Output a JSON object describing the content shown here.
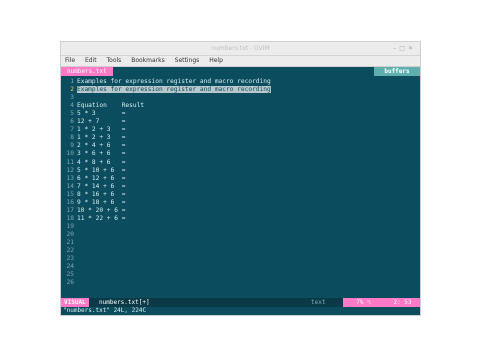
{
  "window": {
    "title": "numbers.txt - GVIM"
  },
  "menu": [
    "File",
    "Edit",
    "Tools",
    "Bookmarks",
    "Settings",
    "Help"
  ],
  "tabs": {
    "active": "numbers.txt",
    "buffers_label": "buffers"
  },
  "editor": {
    "lines": [
      {
        "n": "1",
        "text": "Examples for expression register and macro recording"
      },
      {
        "n": "2",
        "text": "Examples for expression register and macro recording"
      },
      {
        "n": "3",
        "text": ""
      },
      {
        "n": "4",
        "text": "Equation    Result"
      },
      {
        "n": "5",
        "text": "5 * 3       ="
      },
      {
        "n": "6",
        "text": "12 + 7      ="
      },
      {
        "n": "7",
        "text": "1 * 2 + 3   ="
      },
      {
        "n": "8",
        "text": "1 * 2 + 3   ="
      },
      {
        "n": "9",
        "text": "2 * 4 + 6   ="
      },
      {
        "n": "10",
        "text": "3 * 6 + 6   ="
      },
      {
        "n": "11",
        "text": "4 * 8 + 6   ="
      },
      {
        "n": "12",
        "text": "5 * 10 + 6  ="
      },
      {
        "n": "13",
        "text": "6 * 12 + 6  ="
      },
      {
        "n": "14",
        "text": "7 * 14 + 6  ="
      },
      {
        "n": "15",
        "text": "8 * 16 + 6  ="
      },
      {
        "n": "16",
        "text": "9 * 18 + 6  ="
      },
      {
        "n": "17",
        "text": "10 * 20 + 6 ="
      },
      {
        "n": "18",
        "text": "11 * 22 + 6 ="
      },
      {
        "n": "19",
        "text": ""
      },
      {
        "n": "20",
        "text": ""
      },
      {
        "n": "21",
        "text": ""
      },
      {
        "n": "22",
        "text": ""
      },
      {
        "n": "23",
        "text": ""
      },
      {
        "n": "24",
        "text": ""
      },
      {
        "n": "25",
        "text": ""
      },
      {
        "n": "26",
        "text": ""
      }
    ],
    "selected_line": "2"
  },
  "status": {
    "mode": "VISUAL",
    "filename": "numbers.txt[+]",
    "filetype": "text",
    "percent": "7% ␤",
    "position": "2: 53"
  },
  "cmdline": "\"numbers.txt\" 24L, 224C",
  "colors": {
    "background": "#0b4d5e",
    "accent": "#ff79c6",
    "buffers": "#5fafaf"
  }
}
